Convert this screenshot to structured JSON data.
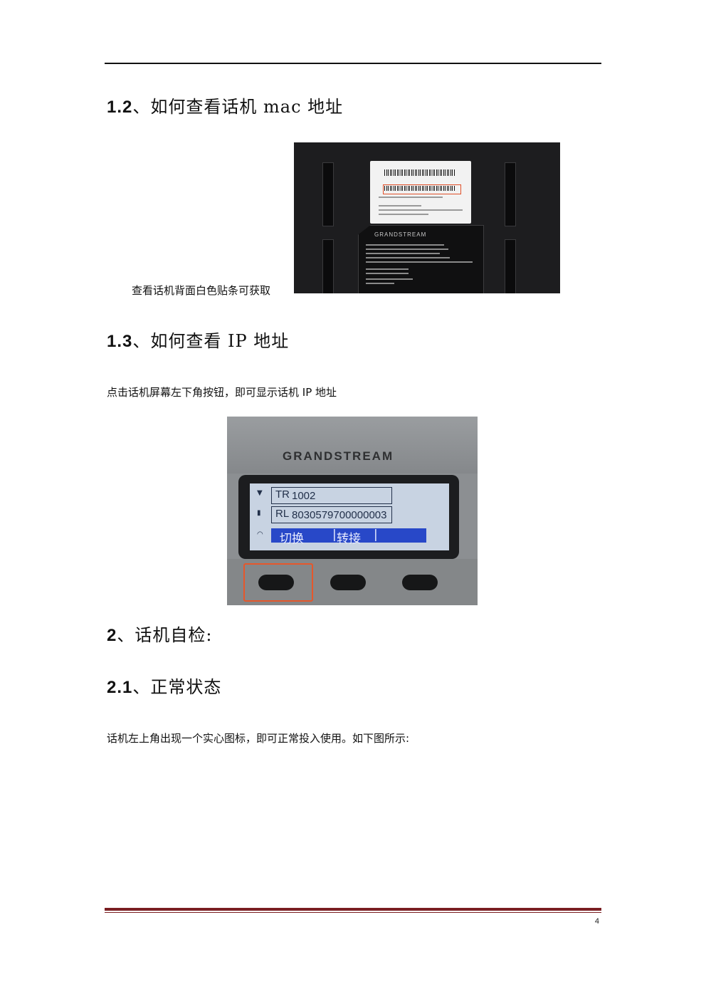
{
  "sections": [
    {
      "number": "1.2",
      "title": "、如何查看话机 mac 地址"
    },
    {
      "number": "1.3",
      "title": "、如何查看 IP 地址"
    },
    {
      "number": "2",
      "title": "、话机自检:"
    },
    {
      "number": "2.1",
      "title": "、正常状态"
    }
  ],
  "caption_mac": "查看话机背面白色贴条可获取",
  "text_ip": "点击话机屏幕左下角按钮，即可显示话机 IP 地址",
  "text_status": "话机左上角出现一个实心图标，即可正常投入使用。如下图所示:",
  "photo_label": {
    "brand": "GRANDSTREAM"
  },
  "photo_screen": {
    "brand": "GRANDSTREAM",
    "row1_tag": "TR",
    "row1_value": "1002",
    "row2_tag": "RL",
    "row2_value": "8030579700000003",
    "softkey1": "切换",
    "softkey2": "转接"
  },
  "page_number": "4",
  "colors": {
    "footer_rule": "#7a1f22",
    "highlight": "#e5572b",
    "lcd_bar": "#2848c8"
  }
}
